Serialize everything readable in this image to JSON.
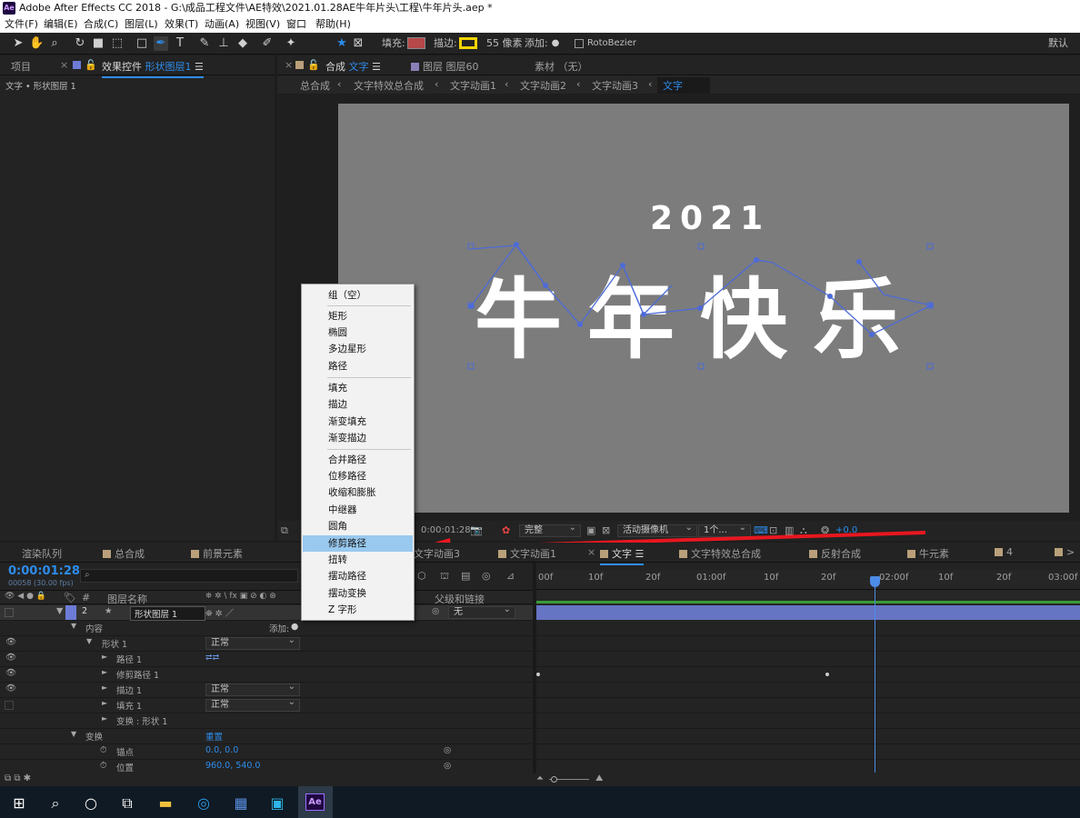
{
  "window": {
    "title": "Adobe After Effects CC 2018 - G:\\成品工程文件\\AE特效\\2021.01.28AE牛年片头\\工程\\牛年片头.aep *",
    "logo": "Ae"
  },
  "menubar": [
    "文件(F)",
    "编辑(E)",
    "合成(C)",
    "图层(L)",
    "效果(T)",
    "动画(A)",
    "视图(V)",
    "窗口",
    "帮助(H)"
  ],
  "toolbar": {
    "fill_label": "填充:",
    "stroke_label": "描边:",
    "stroke_width": "55 像素",
    "add_label": "添加:",
    "rotobezier": "RotoBezier",
    "workspace": "默认",
    "fill_color": "#b54848",
    "stroke_color": "#f4d400"
  },
  "left_panel": {
    "tab_project": "项目",
    "tab_effects_prefix": "效果控件",
    "tab_effects_layer": "形状图层1",
    "breadcrumb": "文字 • 形状图层 1"
  },
  "comp_panel": {
    "tab_comp_prefix": "合成",
    "tab_comp_name": "文字",
    "tab_layer": "图层 图层60",
    "tab_footage": "素材 （无）",
    "breadcrumbs": [
      "总合成",
      "文字特效总合成",
      "文字动画1",
      "文字动画2",
      "文字动画3",
      "文字"
    ],
    "canvas": {
      "year": "2021",
      "greeting": "牛年快乐",
      "bg_color": "#7c7c7c"
    },
    "footer": {
      "timecode": "0:00:01:28",
      "resolution": "完整",
      "camera": "活动摄像机",
      "views": "1个...",
      "exposure": "+0.0"
    }
  },
  "context_menu": {
    "items": [
      "组（空）",
      "矩形",
      "椭圆",
      "多边星形",
      "路径",
      "填充",
      "描边",
      "渐变填充",
      "渐变描边",
      "合并路径",
      "位移路径",
      "收缩和膨胀",
      "中继器",
      "圆角",
      "修剪路径",
      "扭转",
      "摆动路径",
      "摆动变换",
      "Z 字形"
    ],
    "highlighted": "修剪路径"
  },
  "timeline": {
    "tabs": [
      "渲染队列",
      "总合成",
      "前景元素",
      "文字动画3",
      "文字动画1",
      "文字",
      "文字特效总合成",
      "反射合成",
      "牛元素",
      "4"
    ],
    "active_tab": "文字",
    "timecode": "0:00:01:28",
    "frames": "00058 (30.00 fps)",
    "search_placeholder": "",
    "col_layer_name": "图层名称",
    "col_parent": "父级和链接",
    "layer": {
      "index": "2",
      "name": "形状图层 1",
      "parent": "无"
    },
    "rows": {
      "contents": "内容",
      "add": "添加:",
      "shape": "形状 1",
      "path": "路径 1",
      "trim": "修剪路径 1",
      "stroke": "描边 1",
      "fill": "填充 1",
      "xform_shape": "变换 : 形状 1",
      "transform": "变换",
      "reset": "重置",
      "anchor": "锚点",
      "anchor_val": "0.0, 0.0",
      "position": "位置",
      "position_val": "960.0, 540.0",
      "blend": "正常"
    },
    "ruler": [
      "00f",
      "10f",
      "20f",
      "01:00f",
      "10f",
      "20f",
      "02:00f",
      "10f",
      "20f",
      "03:00f"
    ],
    "playhead_time": "02:00f"
  },
  "taskbar": {
    "icons": [
      "windows-icon",
      "search-icon",
      "cortana-icon",
      "task-view-icon",
      "explorer-icon",
      "edge-icon",
      "app1-icon",
      "app2-icon",
      "ae-icon"
    ]
  }
}
